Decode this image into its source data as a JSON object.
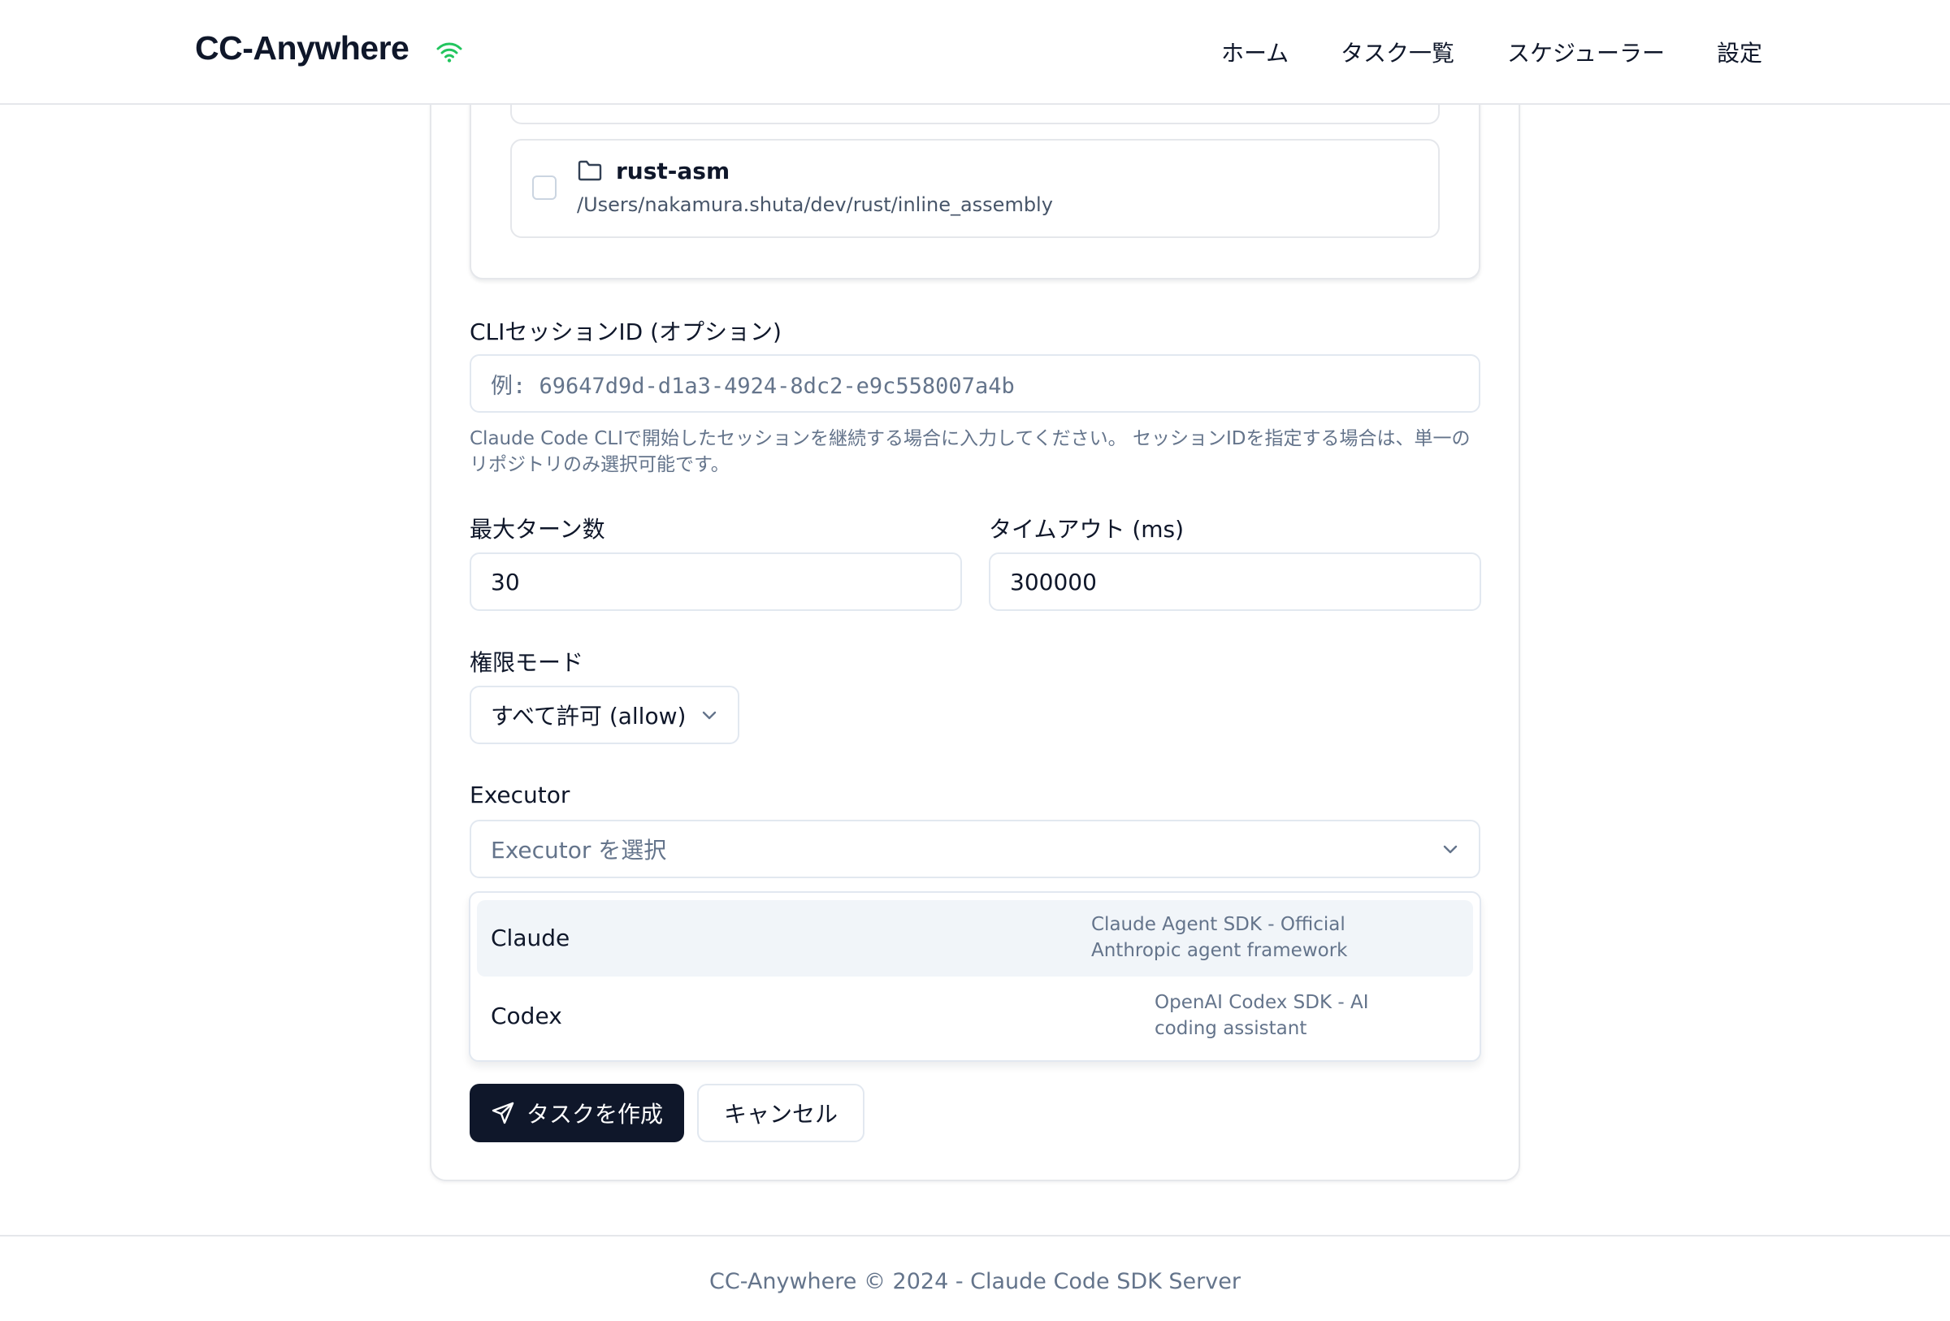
{
  "header": {
    "brand": "CC-Anywhere",
    "status_icon": "wifi-icon",
    "nav": [
      {
        "label": "ホーム"
      },
      {
        "label": "タスク一覧"
      },
      {
        "label": "スケジューラー"
      },
      {
        "label": "設定"
      }
    ]
  },
  "repositories": {
    "items": [
      {
        "name": "rust-asm",
        "path": "/Users/nakamura.shuta/dev/rust/inline_assembly",
        "checked": false,
        "icon": "folder-icon"
      }
    ]
  },
  "form": {
    "session": {
      "label": "CLIセッションID (オプション)",
      "placeholder": "例: 69647d9d-d1a3-4924-8dc2-e9c558007a4b",
      "help": "Claude Code CLIで開始したセッションを継続する場合に入力してください。 セッションIDを指定する場合は、単一のリポジトリのみ選択可能です。"
    },
    "max_turns": {
      "label": "最大ターン数",
      "value": "30"
    },
    "timeout": {
      "label": "タイムアウト (ms)",
      "value": "300000"
    },
    "permission": {
      "label": "権限モード",
      "value": "すべて許可 (allow)"
    },
    "executor": {
      "label": "Executor",
      "placeholder": "Executor を選択",
      "options": [
        {
          "label": "Claude",
          "description": "Claude Agent SDK - Official Anthropic agent framework",
          "desc_line1": "Claude Agent SDK - Official",
          "desc_line2": "Anthropic agent framework",
          "highlighted": true
        },
        {
          "label": "Codex",
          "description": "OpenAI Codex SDK - AI coding assistant",
          "desc_line1": "OpenAI Codex SDK - AI",
          "desc_line2": "coding assistant",
          "highlighted": false
        }
      ]
    }
  },
  "actions": {
    "submit_label": "タスクを作成",
    "submit_icon": "send-icon",
    "cancel_label": "キャンセル"
  },
  "footer": {
    "text": "CC-Anywhere © 2024 - Claude Code SDK Server"
  },
  "colors": {
    "primary": "#0f172a",
    "status_online": "#22c55e",
    "muted_text": "#64748b",
    "border": "#e2e8f0",
    "highlight": "#f1f5f9"
  }
}
